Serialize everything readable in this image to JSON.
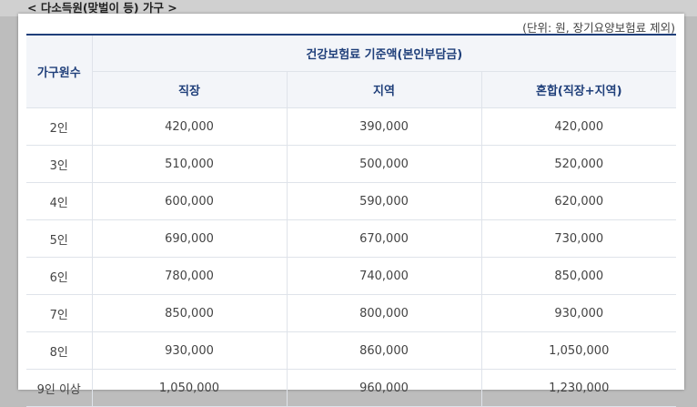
{
  "section_title": "< 다소득원(맞벌이 등) 가구 >",
  "unit_note": "(단위: 원, 장기요양보험료 제외)",
  "table": {
    "row_header": "가구원수",
    "group_header": "건강보험료 기준액(본인부담금)",
    "columns": [
      "직장",
      "지역",
      "혼합(직장+지역)"
    ],
    "rows": [
      {
        "label": "2인",
        "values": [
          "420,000",
          "390,000",
          "420,000"
        ]
      },
      {
        "label": "3인",
        "values": [
          "510,000",
          "500,000",
          "520,000"
        ]
      },
      {
        "label": "4인",
        "values": [
          "600,000",
          "590,000",
          "620,000"
        ]
      },
      {
        "label": "5인",
        "values": [
          "690,000",
          "670,000",
          "730,000"
        ]
      },
      {
        "label": "6인",
        "values": [
          "780,000",
          "740,000",
          "850,000"
        ]
      },
      {
        "label": "7인",
        "values": [
          "850,000",
          "800,000",
          "930,000"
        ]
      },
      {
        "label": "8인",
        "values": [
          "930,000",
          "860,000",
          "1,050,000"
        ]
      },
      {
        "label": "9인 이상",
        "values": [
          "1,050,000",
          "960,000",
          "1,230,000"
        ]
      }
    ]
  }
}
